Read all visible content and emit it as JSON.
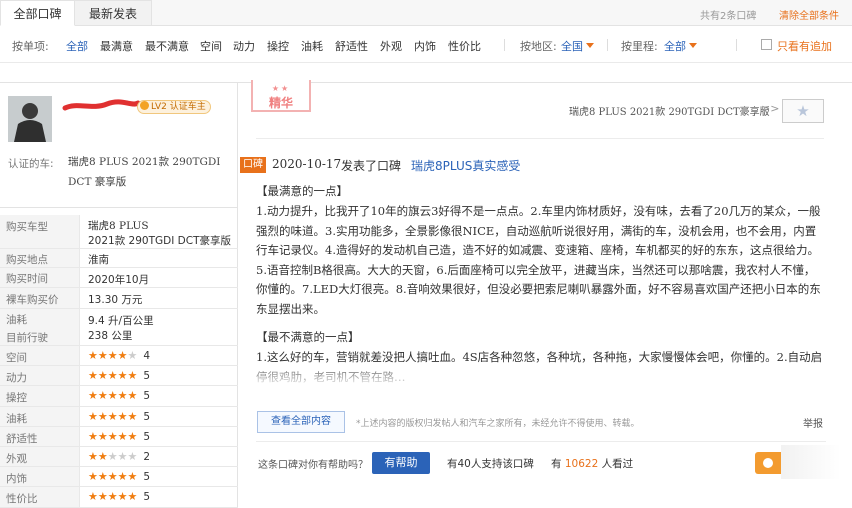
{
  "tabs": {
    "all": "全部口碑",
    "latest": "最新发表"
  },
  "topbar": {
    "count_text": "共有2条口碑",
    "clear_label": "清除全部条件"
  },
  "filter": {
    "label": "按单项:",
    "items": [
      "全部",
      "最满意",
      "最不满意",
      "空间",
      "动力",
      "操控",
      "油耗",
      "舒适性",
      "外观",
      "内饰",
      "性价比"
    ],
    "region_label": "按地区:",
    "region_value": "全国",
    "mileage_label": "按里程:",
    "mileage_value": "全部",
    "only_followup": "只看有追加"
  },
  "user": {
    "badge": "LV2 认证车主",
    "cert_label": "认证的车:",
    "cert_car": "瑞虎8 PLUS 2021款 290TGDI DCT 豪享版"
  },
  "info": {
    "rows": [
      {
        "label": "购买车型",
        "value": "瑞虎8 PLUS",
        "value2": "2021款 290TGDI DCT豪享版"
      },
      {
        "label": "购买地点",
        "value": "淮南"
      },
      {
        "label": "购买时间",
        "value": "2020年10月"
      },
      {
        "label": "裸车购买价",
        "value": "13.30 万元"
      },
      {
        "label": "油耗",
        "value": "9.4 升/百公里"
      },
      {
        "label": "目前行驶",
        "value": "238 公里"
      }
    ],
    "ratings": [
      {
        "label": "空间",
        "score": 4
      },
      {
        "label": "动力",
        "score": 5
      },
      {
        "label": "操控",
        "score": 5
      },
      {
        "label": "油耗",
        "score": 5
      },
      {
        "label": "舒适性",
        "score": 5
      },
      {
        "label": "外观",
        "score": 2
      },
      {
        "label": "内饰",
        "score": 5
      },
      {
        "label": "性价比",
        "score": 5
      }
    ]
  },
  "review": {
    "stamp": "精华",
    "model_link": "瑞虎8 PLUS 2021款 290TGDI DCT豪享版",
    "chevrons": ">>",
    "tag": "口碑",
    "date": "2020-10-17",
    "posted": "发表了口碑",
    "title": "瑞虎8PLUS真实感受",
    "best_heading": "【最满意的一点】",
    "best_text": "1.动力提升，比我开了10年的旗云3好得不是一点点。2.车里内饰材质好，没有味，去看了20几万的某众，一般强烈的味道。3.实用功能多，全景影像很NICE，自动巡航听说很好用，满街的车，没机会用，也不会用，内置行车记录仪。4.造得好的发动机自己造，造不好的如减震、变速箱、座椅，车机都买的好的东东，这点很给力。5.语音控制B格很高。大大的天窗，6.后面座椅可以完全放平，进藏当床，当然还可以那啥震，我农村人不懂，你懂的。7.LED大灯很亮。8.音响效果很好，但没必要把索尼喇叭暴露外面，好不容易喜欢国产还把小日本的东东显摆出来。",
    "worst_heading": "【最不满意的一点】",
    "worst_text": "1.这么好的车，营销就差没把人搞吐血。4S店各种忽悠，各种坑，各种拖，大家慢慢体会吧，你懂的。2.自动启停很鸡肋，老司机不管在路…",
    "view_all": "查看全部内容",
    "copyright": "*上述内容的版权归发帖人和汽车之家所有，未经允许不得使用、转载。",
    "report": "举报",
    "helpful_q": "这条口碑对你有帮助吗？",
    "helpful_btn": "有帮助",
    "support": "有40人支持该口碑",
    "views_prefix": "有",
    "views_count": "10622",
    "views_suffix": "人看过"
  },
  "colors": {
    "accent": "#e8711b",
    "link": "#2b63b8",
    "star": "#f07d10"
  }
}
